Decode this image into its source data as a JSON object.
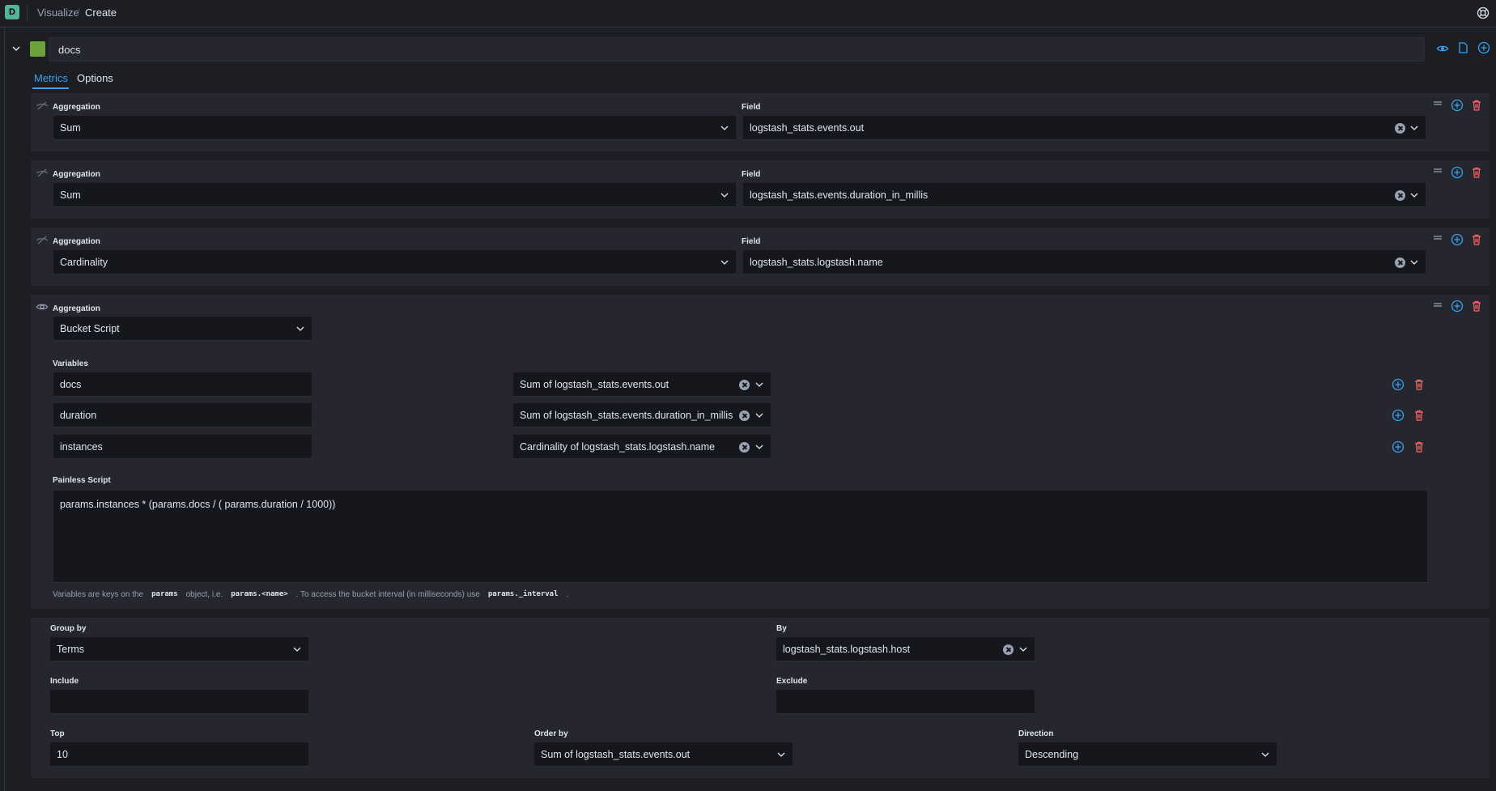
{
  "topbar": {
    "logo_letter": "D",
    "crumb_parent": "Visualize",
    "crumb_current": "Create"
  },
  "agg_header": {
    "name": "docs",
    "swatch_color": "#6ca13b"
  },
  "tabs": [
    {
      "label": "Metrics"
    },
    {
      "label": "Options"
    }
  ],
  "labels": {
    "aggregation": "Aggregation",
    "field": "Field",
    "variables": "Variables",
    "painless_script": "Painless Script",
    "group_by": "Group by",
    "by": "By",
    "include": "Include",
    "exclude": "Exclude",
    "top": "Top",
    "order_by": "Order by",
    "direction": "Direction"
  },
  "metrics": [
    {
      "aggregation": "Sum",
      "field": "logstash_stats.events.out"
    },
    {
      "aggregation": "Sum",
      "field": "logstash_stats.events.duration_in_millis"
    },
    {
      "aggregation": "Cardinality",
      "field": "logstash_stats.logstash.name"
    }
  ],
  "bucket_script": {
    "aggregation": "Bucket Script",
    "variables": [
      {
        "name": "docs",
        "metric": "Sum of logstash_stats.events.out"
      },
      {
        "name": "duration",
        "metric": "Sum of logstash_stats.events.duration_in_millis"
      },
      {
        "name": "instances",
        "metric": "Cardinality of logstash_stats.logstash.name"
      }
    ],
    "script": "params.instances * (params.docs / ( params.duration / 1000))",
    "hint": {
      "p1": "Variables are keys on the",
      "c1": "params",
      "p2": "object, i.e.",
      "c2": "params.<name>",
      "p3": ". To access the bucket interval (in milliseconds) use",
      "c3": "params._interval",
      "p4": "."
    }
  },
  "group": {
    "group_by": "Terms",
    "by": "logstash_stats.logstash.host",
    "include": "",
    "exclude": "",
    "top": "10",
    "order_by": "Sum of logstash_stats.events.out",
    "direction": "Descending"
  },
  "colors": {
    "accent": "#36a2ef",
    "danger": "#f66",
    "background": "#1d1e24",
    "panel": "#25262e"
  }
}
